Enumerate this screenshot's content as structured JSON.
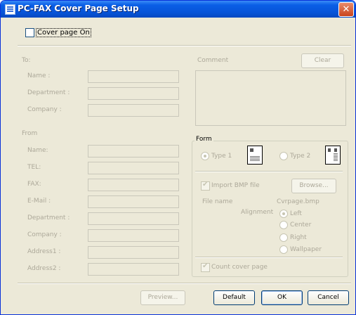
{
  "window": {
    "title": "PC-FAX Cover Page Setup",
    "close_icon": "close-icon"
  },
  "cover_page_checkbox": {
    "label": "Cover page On",
    "checked": false
  },
  "to_section": {
    "heading": "To:",
    "fields": [
      {
        "label": "Name :",
        "value": ""
      },
      {
        "label": "Department :",
        "value": ""
      },
      {
        "label": "Company :",
        "value": ""
      }
    ]
  },
  "comment_section": {
    "label": "Comment",
    "clear_button": "Clear",
    "value": ""
  },
  "from_section": {
    "heading": "From",
    "fields": [
      {
        "label": "Name:",
        "value": ""
      },
      {
        "label": "TEL:",
        "value": ""
      },
      {
        "label": "FAX:",
        "value": ""
      },
      {
        "label": "E-Mail :",
        "value": ""
      },
      {
        "label": "Department :",
        "value": ""
      },
      {
        "label": "Company :",
        "value": ""
      },
      {
        "label": "Address1 :",
        "value": ""
      },
      {
        "label": "Address2 :",
        "value": ""
      }
    ]
  },
  "form_group": {
    "legend": "Form",
    "type1_label": "Type 1",
    "type2_label": "Type 2",
    "selected": "Type 1"
  },
  "bmp_options": {
    "import_label": "Import BMP file",
    "import_checked": true,
    "browse_button": "Browse...",
    "file_name_label": "File name",
    "file_name_value": "Cvrpage.bmp",
    "alignment_label": "Alignment",
    "alignment_options": [
      "Left",
      "Center",
      "Right",
      "Wallpaper"
    ],
    "alignment_selected": "Left",
    "count_cover_label": "Count cover page",
    "count_cover_checked": true
  },
  "footer": {
    "preview_button": "Preview...",
    "default_button": "Default",
    "ok_button": "OK",
    "cancel_button": "Cancel"
  },
  "colors": {
    "titlebar_blue": "#0754d8",
    "dialog_face": "#ece9d8",
    "disabled_text": "#aca899"
  }
}
